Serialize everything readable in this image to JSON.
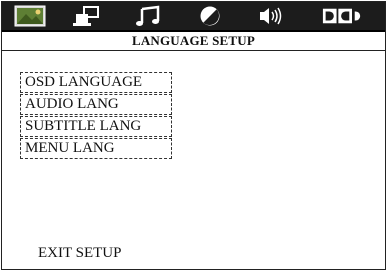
{
  "tabs": [
    {
      "icon": "picture-setup-icon"
    },
    {
      "icon": "system-setup-icon"
    },
    {
      "icon": "music-note-icon"
    },
    {
      "icon": "display-contrast-icon"
    },
    {
      "icon": "speaker-audio-icon"
    },
    {
      "icon": "dolby-icon"
    }
  ],
  "colors": {
    "topbar": "#1c1c1c",
    "icon_active": "#6b8e3a",
    "icon": "#ffffff"
  },
  "header": {
    "title": "LANGUAGE SETUP"
  },
  "menu": {
    "items": [
      {
        "label": "OSD LANGUAGE"
      },
      {
        "label": "AUDIO LANG"
      },
      {
        "label": "SUBTITLE LANG"
      },
      {
        "label": "MENU LANG"
      }
    ]
  },
  "footer": {
    "exit_label": "EXIT SETUP"
  }
}
